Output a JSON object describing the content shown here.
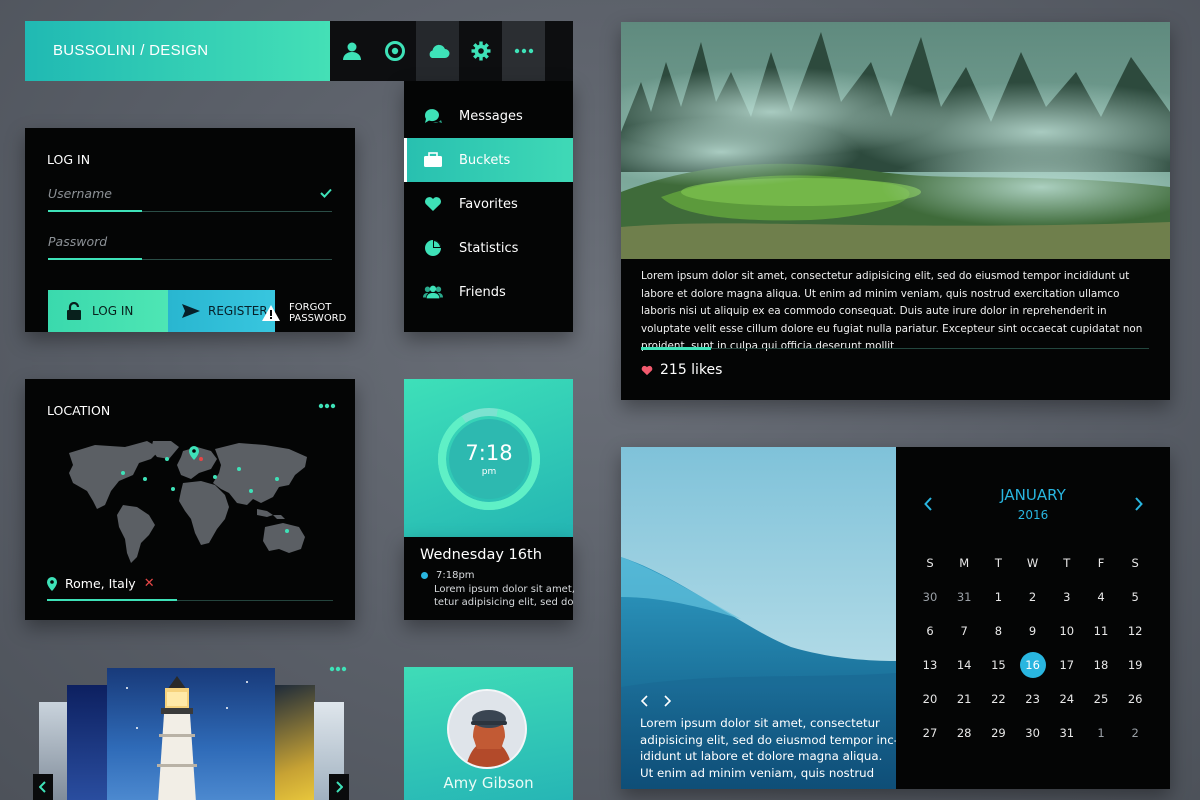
{
  "header": {
    "brand": "BUSSOLINI / DESIGN",
    "icons": [
      "user-icon",
      "target-icon",
      "cloud-icon",
      "gear-icon",
      "more-icon"
    ]
  },
  "menu": {
    "items": [
      {
        "label": "Messages",
        "icon": "chat-icon"
      },
      {
        "label": "Buckets",
        "icon": "bucket-icon"
      },
      {
        "label": "Favorites",
        "icon": "heart-icon"
      },
      {
        "label": "Statistics",
        "icon": "pie-chart-icon"
      },
      {
        "label": "Friends",
        "icon": "users-icon"
      }
    ],
    "selected": "Buckets"
  },
  "login": {
    "title": "LOG IN",
    "username_placeholder": "Username",
    "password_placeholder": "Password",
    "login_label": "LOG IN",
    "register_label": "REGISTER",
    "forgot_line1": "FORGOT",
    "forgot_line2": "PASSWORD"
  },
  "location": {
    "title": "LOCATION",
    "place": "Rome, Italy"
  },
  "clock": {
    "time": "7:18",
    "period": "pm",
    "day": "Wednesday 16th",
    "event_time": "7:18pm",
    "event_text_1": "Lorem ipsum dolor sit amet,",
    "event_text_2": "tetur adipisicing elit, sed do"
  },
  "profile": {
    "name": "Amy Gibson"
  },
  "article": {
    "body": "Lorem ipsum dolor sit amet, consectetur adipisicing elit, sed do eiusmod tempor incididunt ut labore et dolore magna aliqua. Ut enim ad minim veniam, quis nostrud exercitation ullamco laboris nisi ut aliquip ex ea commodo consequat. Duis aute irure dolor in reprehenderit in voluptate velit esse cillum dolore eu fugiat nulla pariatur. Excepteur sint occaecat cupidatat non proident, sunt in culpa qui officia deserunt mollit",
    "likes": "215 likes"
  },
  "wave_card": {
    "text_1": "Lorem ipsum dolor sit amet, consectetur",
    "text_2": "adipisicing elit, sed do eiusmod tempor inc-",
    "text_3": "ididunt ut labore et dolore magna aliqua.",
    "text_4": "Ut enim ad minim veniam, quis nostrud"
  },
  "calendar": {
    "month": "JANUARY",
    "year": "2016",
    "weekdays": [
      "S",
      "M",
      "T",
      "W",
      "T",
      "F",
      "S"
    ],
    "weeks": [
      [
        "30",
        "31",
        "1",
        "2",
        "3",
        "4",
        "5"
      ],
      [
        "6",
        "7",
        "8",
        "9",
        "10",
        "11",
        "12"
      ],
      [
        "13",
        "14",
        "15",
        "16",
        "17",
        "18",
        "19"
      ],
      [
        "20",
        "21",
        "22",
        "23",
        "24",
        "25",
        "26"
      ],
      [
        "27",
        "28",
        "29",
        "30",
        "31",
        "1",
        "2"
      ]
    ],
    "today": "16"
  },
  "colors": {
    "accent": "#3ee2b8",
    "blue": "#29b6e0",
    "panel": "#040505",
    "heart": "#f25a6e"
  }
}
